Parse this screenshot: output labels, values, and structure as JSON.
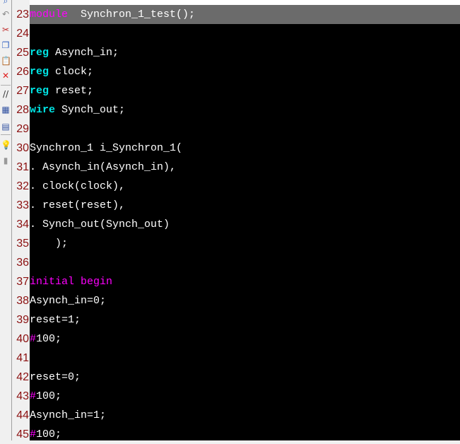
{
  "toolbar": {
    "icons": [
      "find-icon",
      "undo-icon",
      "cut-icon",
      "copy-icon",
      "paste-icon",
      "delete-icon",
      "comment-icon",
      "block-select-icon",
      "bookmark-icon",
      "hint-icon",
      "clear-icon"
    ]
  },
  "colors": {
    "keyword": "#00e5e5",
    "keyword_purple": "#ff00ff",
    "text": "#ffffff",
    "line_number": "#8b1010",
    "highlight": "#6b6b6b"
  },
  "lines": [
    {
      "n": "23",
      "hl": true,
      "t": [
        [
          "kp",
          "module"
        ],
        [
          "",
          "  Synchron_1_test();"
        ]
      ]
    },
    {
      "n": "24",
      "t": []
    },
    {
      "n": "25",
      "t": [
        [
          "kw",
          "reg"
        ],
        [
          "",
          " Asynch_in;"
        ]
      ]
    },
    {
      "n": "26",
      "t": [
        [
          "kw",
          "reg"
        ],
        [
          "",
          " clock;"
        ]
      ]
    },
    {
      "n": "27",
      "t": [
        [
          "kw",
          "reg"
        ],
        [
          "",
          " reset;"
        ]
      ]
    },
    {
      "n": "28",
      "t": [
        [
          "kw",
          "wire"
        ],
        [
          "",
          " Synch_out;"
        ]
      ]
    },
    {
      "n": "29",
      "t": []
    },
    {
      "n": "30",
      "t": [
        [
          "",
          "Synchron_1 i_Synchron_1("
        ]
      ]
    },
    {
      "n": "31",
      "t": [
        [
          "",
          ". Asynch_in(Asynch_in),"
        ]
      ]
    },
    {
      "n": "32",
      "t": [
        [
          "",
          ". clock(clock),"
        ]
      ]
    },
    {
      "n": "33",
      "t": [
        [
          "",
          ". reset(reset),"
        ]
      ]
    },
    {
      "n": "34",
      "t": [
        [
          "",
          ". Synch_out(Synch_out)"
        ]
      ]
    },
    {
      "n": "35",
      "t": [
        [
          "",
          "    );"
        ]
      ]
    },
    {
      "n": "36",
      "t": []
    },
    {
      "n": "37",
      "t": [
        [
          "kp",
          "initial begin"
        ]
      ]
    },
    {
      "n": "38",
      "t": [
        [
          "",
          "Asynch_in=0;"
        ]
      ]
    },
    {
      "n": "39",
      "t": [
        [
          "",
          "reset=1;"
        ]
      ]
    },
    {
      "n": "40",
      "t": [
        [
          "kp",
          "#"
        ],
        [
          "",
          "100;"
        ]
      ]
    },
    {
      "n": "41",
      "t": []
    },
    {
      "n": "42",
      "t": [
        [
          "",
          "reset=0;"
        ]
      ]
    },
    {
      "n": "43",
      "t": [
        [
          "kp",
          "#"
        ],
        [
          "",
          "100;"
        ]
      ]
    },
    {
      "n": "44",
      "t": [
        [
          "",
          "Asynch_in=1;"
        ]
      ]
    },
    {
      "n": "45",
      "t": [
        [
          "kp",
          "#"
        ],
        [
          "",
          "100;"
        ]
      ]
    }
  ]
}
